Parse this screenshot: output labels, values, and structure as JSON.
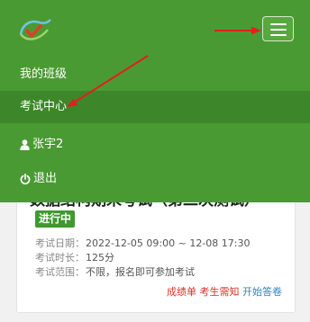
{
  "menu": {
    "items": [
      {
        "label": "我的班级"
      },
      {
        "label": "考试中心"
      },
      {
        "label": "张宇2"
      },
      {
        "label": "退出"
      }
    ]
  },
  "exam": {
    "title_partial": "数据结构期末考试（第二次测试）",
    "status": "进行中",
    "date_label": "考试日期：",
    "date_value": "2022-12-05 09:00 ~ 12-08 17:30",
    "duration_label": "考试时长：",
    "duration_value": "125分",
    "scope_label": "考试范围：",
    "scope_value": "不限，报名即可参加考试",
    "link_scores": "成绩单",
    "link_notice": "考生需知",
    "link_start": "开始答卷"
  },
  "colors": {
    "navbar_bg": "#4a9a33",
    "active_item_bg": "#3d872a",
    "annotation_red": "#e02020",
    "link_red": "#d9322b",
    "link_blue": "#2d86c4"
  }
}
